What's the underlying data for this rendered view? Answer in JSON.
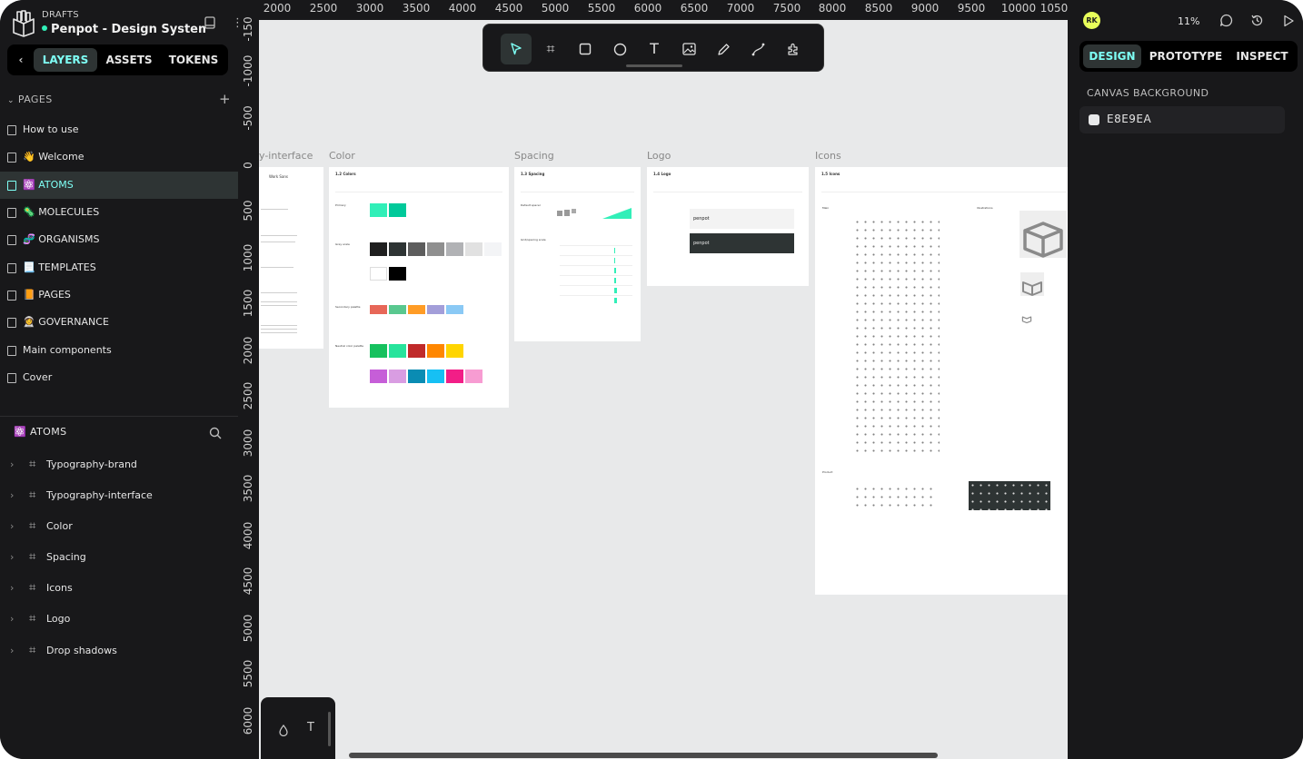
{
  "header": {
    "section": "DRAFTS",
    "project_name": "Penpot - Design System v"
  },
  "left_tabs": [
    "LAYERS",
    "ASSETS",
    "TOKENS"
  ],
  "pages": {
    "title": "PAGES",
    "items": [
      "How to use",
      "👋 Welcome",
      "⚛️ ATOMS",
      "🦠 MOLECULES",
      "🧬 ORGANISMS",
      "📃 TEMPLATES",
      "📙 PAGES",
      "👩‍🚀 GOVERNANCE",
      "Main components",
      "Cover"
    ]
  },
  "layers": {
    "title": "⚛️ ATOMS",
    "items": [
      "Typography-brand",
      "Typography-interface",
      "Color",
      "Spacing",
      "Icons",
      "Logo",
      "Drop shadows"
    ]
  },
  "ruler_top": [
    "2000",
    "2500",
    "3000",
    "3500",
    "4000",
    "4500",
    "5000",
    "5500",
    "6000",
    "6500",
    "7000",
    "7500",
    "8000",
    "8500",
    "9000",
    "9500",
    "10000",
    "1050"
  ],
  "ruler_left": [
    "-150",
    "-1000",
    "-500",
    "0",
    "500",
    "1000",
    "1500",
    "2000",
    "2500",
    "3000",
    "3500",
    "4000",
    "4500",
    "5000",
    "5500",
    "6000"
  ],
  "boards": [
    "y-interface",
    "Color",
    "Spacing",
    "Logo",
    "Icons"
  ],
  "board_content": {
    "typo": {
      "title": "Work Sans"
    },
    "color": {
      "title": "1.2 Colors",
      "sections": [
        "Primary",
        "Grey scale",
        "Secondary palette",
        "Neutral color palette"
      ]
    },
    "spacing": {
      "title": "1.3 Spacing",
      "sections": [
        "Default spacer",
        "Grid/spacing scale"
      ]
    },
    "logo": {
      "title": "1.4 Logo",
      "brand_light": "penpot",
      "brand_dark": "penpot"
    },
    "icons": {
      "title": "1.5 Icons",
      "sections": [
        "Main",
        "Illustrations",
        "Product"
      ]
    }
  },
  "right": {
    "avatar": "RK",
    "zoom": "11%",
    "tabs": [
      "DESIGN",
      "PROTOTYPE",
      "INSPECT"
    ],
    "canvas_background_label": "CANVAS BACKGROUND",
    "canvas_background_hex": "E8E9EA"
  },
  "colors": {
    "accent": "#7efff5",
    "canvas": "#e8e9ea",
    "panel": "#18181a"
  }
}
